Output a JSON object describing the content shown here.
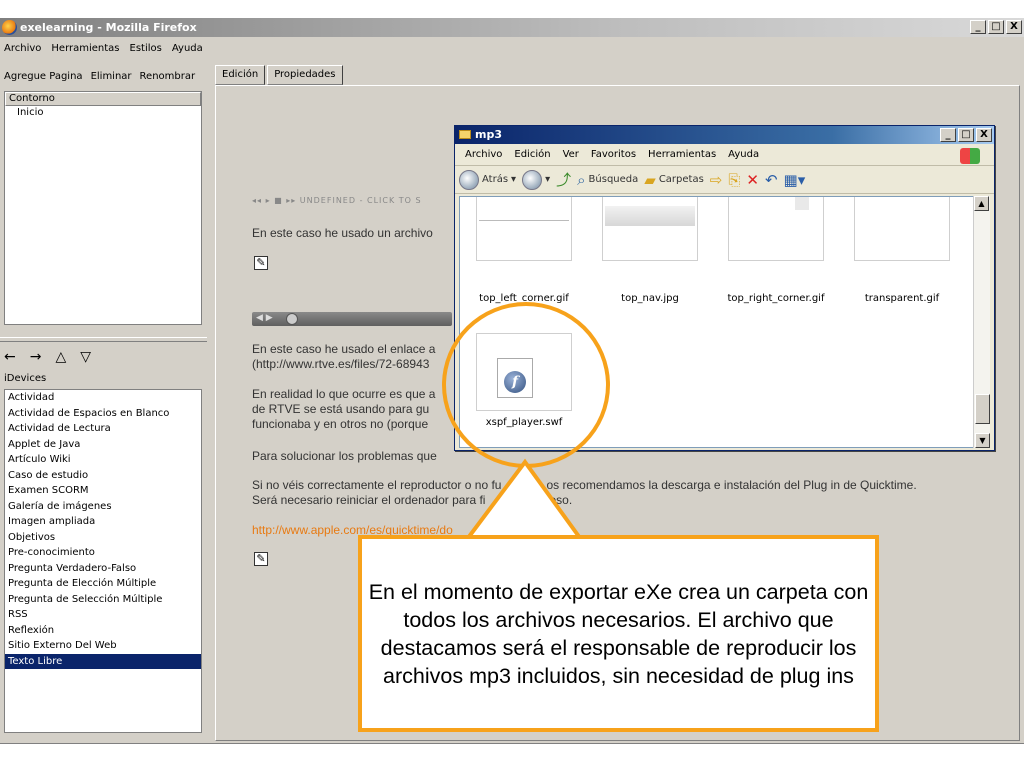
{
  "window": {
    "title": "exelearning - Mozilla Firefox",
    "buttons": [
      "_",
      "□",
      "X"
    ]
  },
  "menu": [
    "Archivo",
    "Herramientas",
    "Estilos",
    "Ayuda"
  ],
  "outline": {
    "toolbar": [
      "Agregue Pagina",
      "Eliminar",
      "Renombrar"
    ],
    "header": "Contorno",
    "items": [
      "Inicio"
    ],
    "arrows": [
      "←",
      "→",
      "△",
      "▽"
    ]
  },
  "idevices": {
    "label": "iDevices",
    "items": [
      "Actividad",
      "Actividad de Espacios en Blanco",
      "Actividad de Lectura",
      "Applet de Java",
      "Artículo Wiki",
      "Caso de estudio",
      "Examen SCORM",
      "Galería de imágenes",
      "Imagen ampliada",
      "Objetivos",
      "Pre-conocimiento",
      "Pregunta Verdadero-Falso",
      "Pregunta de Elección Múltiple",
      "Pregunta de Selección Múltiple",
      "RSS",
      "Reflexión",
      "Sitio Externo Del Web",
      "Texto Libre"
    ],
    "selected": "Texto Libre"
  },
  "editor": {
    "tabs": [
      "Edición",
      "Propiedades"
    ],
    "player1": "◂◂ ▸ ■ ▸▸  UNDEFINED - CLICK TO S",
    "text1": "En este caso he usado un archivo",
    "text2a": "En este caso he usado el enlace a",
    "text2b": "(http://www.rtve.es/files/72-68943",
    "text3a": "En realidad lo que ocurre es que a",
    "text3b": "de RTVE se está usando para gu",
    "text3c": "funcionaba y en otros no (porque",
    "text4": "Para solucionar los problemas que",
    "text5a": "Si no véis correctamente el reproductor o no fu",
    "text5a_tail": "na, os recomendamos la descarga e instalación del Plug in de Quicktime.",
    "text5b": "Será necesario reiniciar el ordenador para fi",
    "text5b_tail": "el proceso.",
    "link": "http://www.apple.com/es/quicktime/do"
  },
  "explorer": {
    "title": "mp3",
    "menu": [
      "Archivo",
      "Edición",
      "Ver",
      "Favoritos",
      "Herramientas",
      "Ayuda"
    ],
    "toolbar": {
      "back": "Atrás",
      "search": "Búsqueda",
      "folders": "Carpetas"
    },
    "files": [
      "top_left_corner.gif",
      "top_nav.jpg",
      "top_right_corner.gif",
      "transparent.gif",
      "xspf_player.swf"
    ]
  },
  "callout": {
    "text": "En el momento de exportar eXe crea un carpeta con todos los archivos necesarios. El archivo que destacamos será el responsable de reproducir los archivos mp3 incluidos, sin necesidad de plug ins"
  },
  "colors": {
    "highlight": "#f7a21b",
    "selection": "#0a246a",
    "link": "#e87a12"
  }
}
